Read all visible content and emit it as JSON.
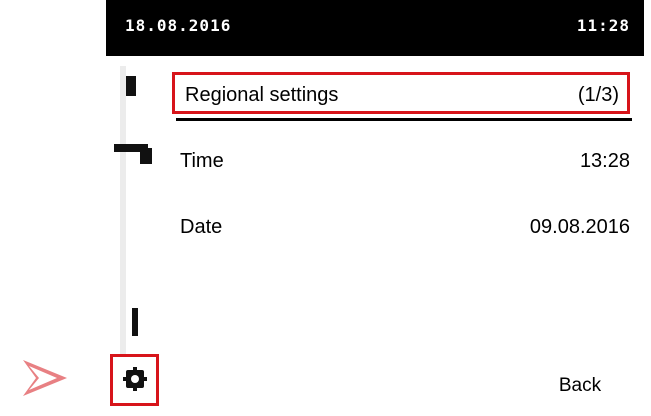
{
  "status_bar": {
    "date": "18.08.2016",
    "time": "11:28"
  },
  "menu": {
    "header_title": "Regional settings",
    "header_page": "(1/3)",
    "rows": [
      {
        "label": "Time",
        "value": "13:28"
      },
      {
        "label": "Date",
        "value": "09.08.2016"
      }
    ]
  },
  "footer": {
    "back_label": "Back"
  },
  "colors": {
    "highlight": "#d7141a",
    "status_bar_bg": "#000000",
    "status_bar_fg": "#ffffff",
    "text": "#000000"
  },
  "icons": {
    "settings": "gear-icon",
    "pointer": "pointer-arrow-icon"
  }
}
